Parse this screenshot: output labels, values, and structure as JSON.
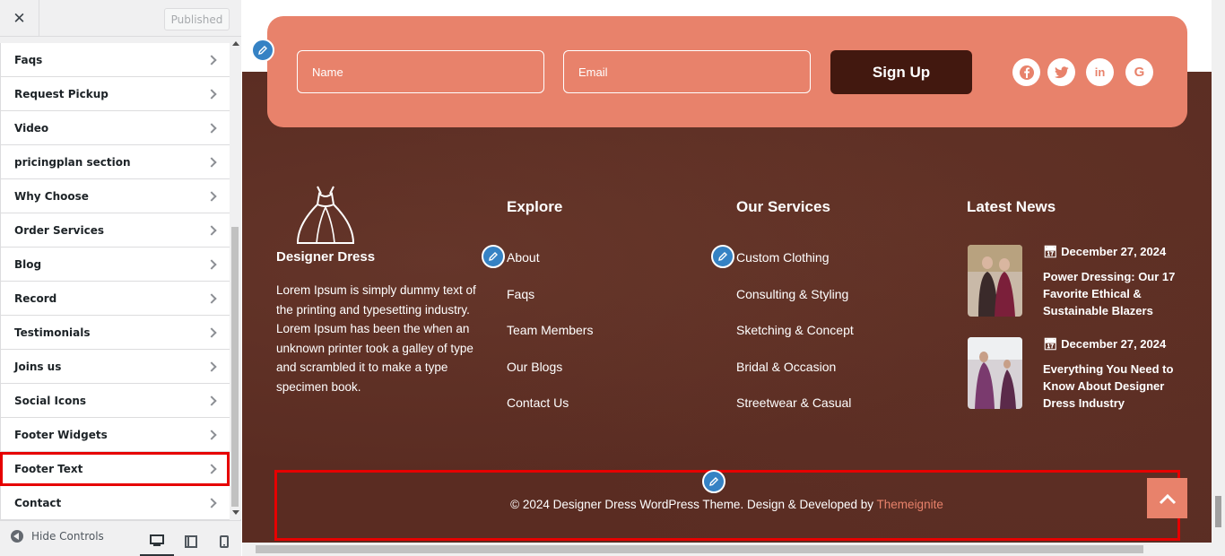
{
  "sidebar": {
    "close_label": "✕",
    "publish_label": "Published",
    "items": [
      {
        "label": "Faqs"
      },
      {
        "label": "Request Pickup"
      },
      {
        "label": "Video"
      },
      {
        "label": "pricingplan section"
      },
      {
        "label": "Why Choose"
      },
      {
        "label": "Order Services"
      },
      {
        "label": "Blog"
      },
      {
        "label": "Record"
      },
      {
        "label": "Testimonials"
      },
      {
        "label": "Joins us"
      },
      {
        "label": "Social Icons"
      },
      {
        "label": "Footer Widgets"
      },
      {
        "label": "Footer Text",
        "active": true
      },
      {
        "label": "Contact"
      }
    ],
    "hide_controls_label": "Hide Controls"
  },
  "newsletter": {
    "name_placeholder": "Name",
    "email_placeholder": "Email",
    "signup_label": "Sign Up",
    "social_icons": [
      "facebook-icon",
      "twitter-icon",
      "linkedin-icon",
      "google-icon"
    ]
  },
  "footer": {
    "brand_name": "Designer Dress",
    "brand_description": "Lorem Ipsum is simply dummy text of the printing and typesetting industry. Lorem Ipsum has been the when an unknown printer took a galley of type and scrambled it to make a type specimen book.",
    "explore": {
      "title": "Explore",
      "links": [
        "About",
        "Faqs",
        "Team Members",
        "Our Blogs",
        "Contact Us"
      ]
    },
    "services": {
      "title": "Our Services",
      "links": [
        "Custom Clothing",
        "Consulting & Styling",
        "Sketching & Concept",
        "Bridal & Occasion",
        "Streetwear & Casual"
      ]
    },
    "news": {
      "title": "Latest News",
      "items": [
        {
          "date": "December 27, 2024",
          "title": "Power Dressing: Our 17 Favorite Ethical & Sustainable Blazers"
        },
        {
          "date": "December 27, 2024",
          "title": "Everything You Need to Know About Designer Dress Industry"
        }
      ]
    },
    "copyright_text": "© 2024 Designer Dress WordPress Theme. Design & Developed by ",
    "copyright_link": "Themeignite"
  },
  "colors": {
    "accent": "#e8826b",
    "footer_bg": "#5a2c22",
    "signup_bg": "#42180f",
    "highlight": "#e60000",
    "edit_pencil": "#3582c4"
  }
}
